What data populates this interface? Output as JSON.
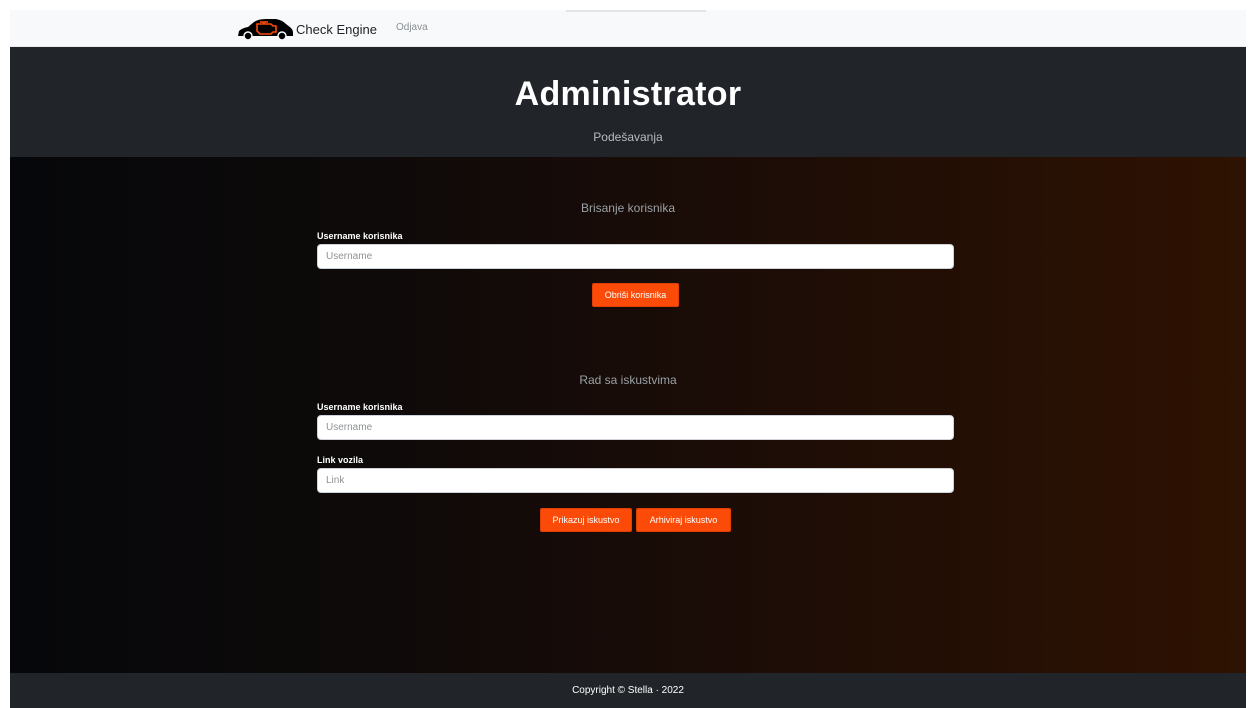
{
  "navbar": {
    "brand_name": "Check Engine",
    "logout_label": "Odjava",
    "logo_colors": {
      "car": "#000000",
      "engine_light": "#fc4b08"
    }
  },
  "hero": {
    "title": "Administrator",
    "subtitle": "Podešavanja"
  },
  "delete_user": {
    "section_title": "Brisanje korisnika",
    "username_label": "Username korisnika",
    "username_placeholder": "Username",
    "username_value": "",
    "delete_button_label": "Obriši korisnika"
  },
  "experiences": {
    "section_title": "Rad sa iskustvima",
    "username_label": "Username korisnika",
    "username_placeholder": "Username",
    "username_value": "",
    "link_label": "Link vozila",
    "link_placeholder": "Link",
    "link_value": "",
    "show_button_label": "Prikazuj iskustvo",
    "archive_button_label": "Arhiviraj iskustvo"
  },
  "footer": {
    "copyright": "Copyright © Stella · 2022"
  },
  "colors": {
    "accent": "#fc4b08",
    "dark_bg": "#212529",
    "navbar_bg": "#f8f9fa"
  }
}
